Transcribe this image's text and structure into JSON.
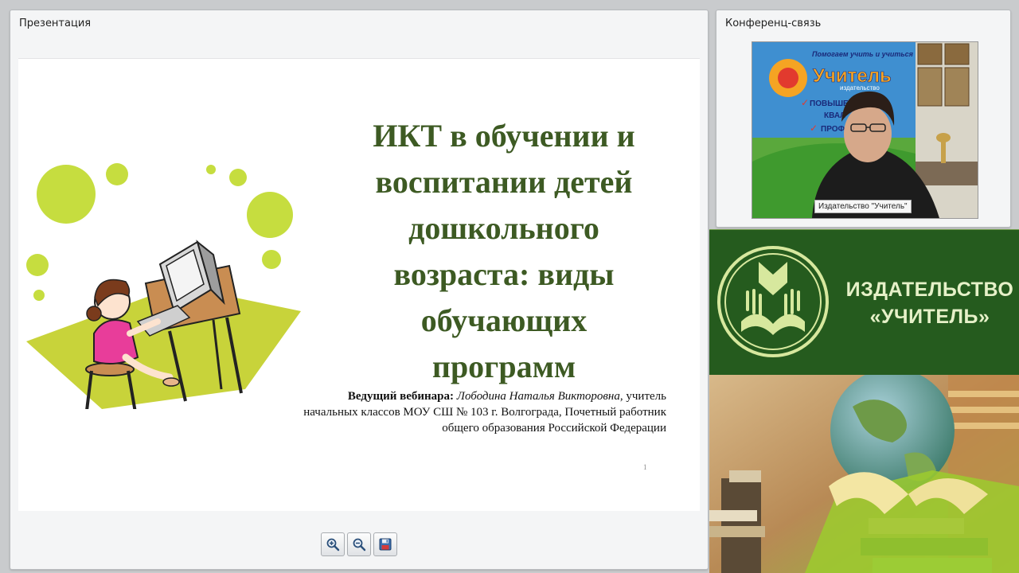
{
  "presentation": {
    "panel_title": "Презентация",
    "slide": {
      "title_lines": [
        "ИКТ в обучении и",
        "воспитании детей",
        "дошкольного",
        "возраста: виды",
        "обучающих",
        "программ"
      ],
      "byline": {
        "label": "Ведущий вебинара:",
        "presenter": "Лободина Наталья Викторовна",
        "line1_rest": ", учитель",
        "line2": "начальных классов МОУ СШ № 103 г. Волгограда, Почетный работник",
        "line3": "общего образования Российской Федерации"
      },
      "page_number": "1"
    },
    "toolbar": {
      "zoom_in_icon": "zoom-in-icon",
      "zoom_out_icon": "zoom-out-icon",
      "save_icon": "floppy-disk-icon"
    }
  },
  "conference": {
    "panel_title": "Конференц-связь",
    "video_caption": "Издательство \"Учитель\"",
    "video_poster": {
      "line1": "Помогаем учить и учиться",
      "logo_word": "Учитель",
      "logo_sub": "издательство",
      "check1": "ПОВЫШЕН",
      "check2": "КВАЛ",
      "check3": "ПРОФ"
    }
  },
  "brand": {
    "line1": "ИЗДАТЕЛЬСТВО",
    "line2": "«УЧИТЕЛЬ»",
    "colors": {
      "banner_bg": "#255b1e",
      "text": "#e6f1c8"
    }
  },
  "colors": {
    "slide_title": "#3d5a23",
    "bubble": "#c6dd3f",
    "floor": "#c8d33a"
  }
}
